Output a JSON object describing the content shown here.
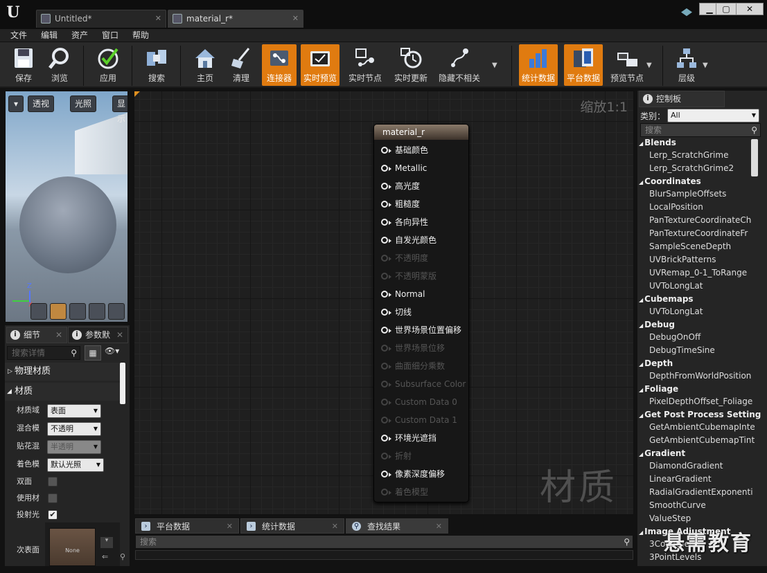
{
  "window": {
    "logo": "U",
    "tabs": [
      {
        "label": "Untitled*"
      },
      {
        "label": "material_r*"
      }
    ],
    "close": "✕"
  },
  "menu": [
    "文件",
    "编辑",
    "资产",
    "窗口",
    "帮助"
  ],
  "toolbar": [
    {
      "label": "保存",
      "icon": "save-icon",
      "active": false
    },
    {
      "label": "浏览",
      "icon": "browse-icon",
      "active": false
    },
    {
      "label": "应用",
      "icon": "apply-icon",
      "active": false
    },
    {
      "label": "搜索",
      "icon": "search-icon",
      "active": false
    },
    {
      "label": "主页",
      "icon": "home-icon",
      "active": false
    },
    {
      "label": "清理",
      "icon": "clean-icon",
      "active": false
    },
    {
      "label": "连接器",
      "icon": "connector-icon",
      "active": true
    },
    {
      "label": "实时预览",
      "icon": "live-preview-icon",
      "active": true
    },
    {
      "label": "实时节点",
      "icon": "live-nodes-icon",
      "active": false
    },
    {
      "label": "实时更新",
      "icon": "live-update-icon",
      "active": false
    },
    {
      "label": "隐藏不相关",
      "icon": "hide-unrelated-icon",
      "active": false
    },
    {
      "label": "统计数据",
      "icon": "stats-icon",
      "active": true
    },
    {
      "label": "平台数据",
      "icon": "platform-stats-icon",
      "active": true
    },
    {
      "label": "预览节点",
      "icon": "preview-nodes-icon",
      "active": false
    },
    {
      "label": "层级",
      "icon": "hierarchy-icon",
      "active": false
    }
  ],
  "viewport": {
    "buttons": [
      "透视",
      "光照",
      "显示"
    ],
    "axes": {
      "z": "Z",
      "x": "X"
    }
  },
  "details": {
    "tabs": [
      "细节",
      "参数默"
    ],
    "search_placeholder": "搜索详情",
    "categories": [
      "物理材质",
      "材质"
    ],
    "props": [
      {
        "label": "材质域",
        "value": "表面",
        "type": "combo",
        "disabled": false
      },
      {
        "label": "混合模式",
        "value": "不透明",
        "type": "combo",
        "disabled": false
      },
      {
        "label": "贴花混合",
        "value": "半透明",
        "type": "combo",
        "disabled": true
      },
      {
        "label": "着色模型",
        "value": "默认光照",
        "type": "combo",
        "disabled": false
      },
      {
        "label": "双面",
        "value": false,
        "type": "check"
      },
      {
        "label": "使用材质",
        "value": false,
        "type": "check"
      },
      {
        "label": "投射光线",
        "value": true,
        "type": "check"
      },
      {
        "label": "次表面轮",
        "value": "None",
        "type": "texture"
      }
    ]
  },
  "graph": {
    "zoom": "缩放1:1",
    "watermark": "材质",
    "node": {
      "title": "material_r",
      "pins": [
        {
          "label": "基础颜色",
          "enabled": true
        },
        {
          "label": "Metallic",
          "enabled": true
        },
        {
          "label": "高光度",
          "enabled": true
        },
        {
          "label": "粗糙度",
          "enabled": true
        },
        {
          "label": "各向异性",
          "enabled": true
        },
        {
          "label": "自发光颜色",
          "enabled": true
        },
        {
          "label": "不透明度",
          "enabled": false
        },
        {
          "label": "不透明蒙版",
          "enabled": false
        },
        {
          "label": "Normal",
          "enabled": true
        },
        {
          "label": "切线",
          "enabled": true
        },
        {
          "label": "世界场景位置偏移",
          "enabled": true
        },
        {
          "label": "世界场景位移",
          "enabled": false
        },
        {
          "label": "曲面细分乘数",
          "enabled": false
        },
        {
          "label": "Subsurface Color",
          "enabled": false
        },
        {
          "label": "Custom Data 0",
          "enabled": false
        },
        {
          "label": "Custom Data 1",
          "enabled": false
        },
        {
          "label": "环境光遮挡",
          "enabled": true
        },
        {
          "label": "折射",
          "enabled": false
        },
        {
          "label": "像素深度偏移",
          "enabled": true
        },
        {
          "label": "着色模型",
          "enabled": false
        }
      ]
    }
  },
  "bottom_tabs": [
    "平台数据",
    "统计数据",
    "查找结果"
  ],
  "bottom_search_placeholder": "搜索",
  "palette": {
    "tab": "控制板",
    "category_label": "类别：",
    "category_value": "All",
    "search_placeholder": "搜索",
    "groups": [
      {
        "name": "Blends",
        "items": [
          "Lerp_ScratchGrime",
          "Lerp_ScratchGrime2"
        ]
      },
      {
        "name": "Coordinates",
        "items": [
          "BlurSampleOffsets",
          "LocalPosition",
          "PanTextureCoordinateCh",
          "PanTextureCoordinateFr",
          "SampleSceneDepth",
          "UVBrickPatterns",
          "UVRemap_0-1_ToRange",
          "UVToLongLat"
        ]
      },
      {
        "name": "Cubemaps",
        "items": [
          "UVToLongLat"
        ]
      },
      {
        "name": "Debug",
        "items": [
          "DebugOnOff",
          "DebugTimeSine"
        ]
      },
      {
        "name": "Depth",
        "items": [
          "DepthFromWorldPosition"
        ]
      },
      {
        "name": "Foliage",
        "items": [
          "PixelDepthOffset_Foliage"
        ]
      },
      {
        "name": "Get Post Process Setting",
        "items": [
          "GetAmbientCubemapInte",
          "GetAmbientCubemapTint"
        ]
      },
      {
        "name": "Gradient",
        "items": [
          "DiamondGradient",
          "LinearGradient",
          "RadialGradientExponenti",
          "SmoothCurve",
          "ValueStep"
        ]
      },
      {
        "name": "Image Adjustment",
        "items": [
          "3ColorBlend",
          "3PointLevels"
        ]
      }
    ]
  },
  "brand_watermark": "悬需教育"
}
